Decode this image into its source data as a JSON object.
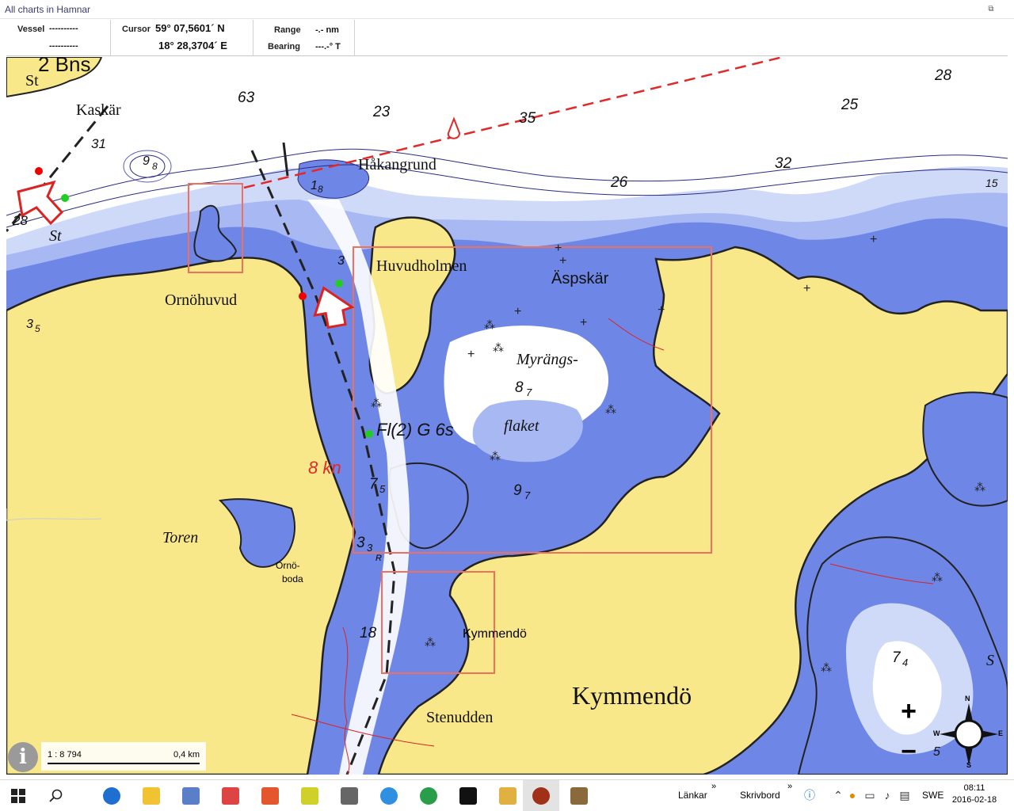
{
  "window": {
    "title": "All charts in Hamnar",
    "restore_glyph": "⧉"
  },
  "infobar": {
    "vessel_label": "Vessel",
    "vessel_line1": "----------",
    "vessel_line2": "----------",
    "cursor_label": "Cursor",
    "cursor_lat": "59° 07,5601´ N",
    "cursor_lon": "18° 28,3704´ E",
    "range_label": "Range",
    "range_value": "-.- nm",
    "bearing_label": "Bearing",
    "bearing_value": "---.-° T"
  },
  "chart": {
    "colors": {
      "land": "#f9e88a",
      "shallow": "#6e86e6",
      "mid": "#a7b8f2",
      "deep": "#cfdaf9",
      "open": "#ffffff",
      "coast": "#222222",
      "route": "#e02a2a",
      "highlight": "#f07060"
    },
    "place_names": [
      "2 Bns",
      "St",
      "Kaskär",
      "Håkangrund",
      "Huvudholmen",
      "Äspskär",
      "Ornöhuvud",
      "Myrängs-",
      "flaket",
      "Toren",
      "Ornö-",
      "boda",
      "Kymmendö",
      "Stenudden",
      "Kymmendö",
      "St",
      "R",
      "S"
    ],
    "depths": [
      "63",
      "23",
      "35",
      "28",
      "25",
      "32",
      "26",
      "31",
      "28",
      "9",
      "8",
      "1",
      "8",
      "3",
      "3",
      "5",
      "8",
      "7",
      "9",
      "7",
      "7",
      "5",
      "3",
      "3",
      "18",
      "7",
      "4",
      "5",
      "15"
    ],
    "light_label": "Fl(2) G 6s",
    "speed_label": "8 kn"
  },
  "scale": {
    "ratio": "1 : 8 794",
    "distance": "0,4 km"
  },
  "controls": {
    "zoom_in": "+",
    "zoom_out": "−",
    "info": "i",
    "compass_n": "N",
    "compass_s": "S",
    "compass_w": "W",
    "compass_e": "E"
  },
  "taskbar": {
    "links_label": "Länkar",
    "desktop_label": "Skrivbord",
    "chevron": "»",
    "language": "SWE",
    "time": "08:11",
    "date": "2016-02-18"
  }
}
